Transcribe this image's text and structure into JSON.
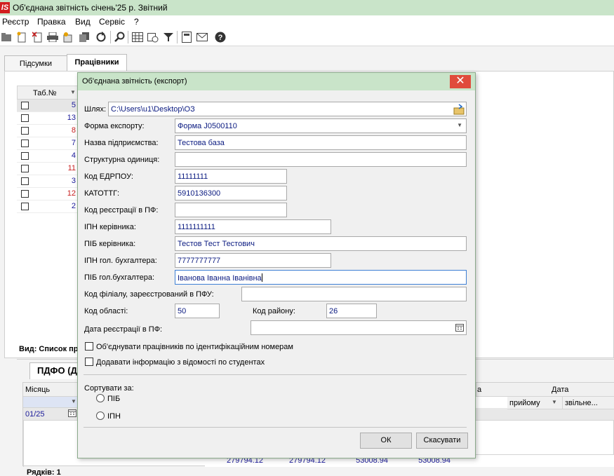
{
  "app": {
    "logo": "IS",
    "title": "Об'єднана звітність січень'25 р. Звітний"
  },
  "menu": [
    "Реєстр",
    "Правка",
    "Вид",
    "Сервіс",
    "?"
  ],
  "tabs": [
    "Підсумки",
    "Працівники"
  ],
  "workers": {
    "header": "Таб.№",
    "rows": [
      {
        "num": "5",
        "color": "#1a1a9a"
      },
      {
        "num": "13",
        "color": "#1a1a9a"
      },
      {
        "num": "8",
        "color": "#c81e1e"
      },
      {
        "num": "7",
        "color": "#1a1a9a"
      },
      {
        "num": "4",
        "color": "#1a1a9a"
      },
      {
        "num": "11",
        "color": "#c81e1e"
      },
      {
        "num": "3",
        "color": "#1a1a9a"
      },
      {
        "num": "12",
        "color": "#c81e1e"
      },
      {
        "num": "2",
        "color": "#1a1a9a"
      }
    ]
  },
  "view_label": "Вид: Список пра",
  "bottom": {
    "tab": "ПДФО (До",
    "col_month": "Місяць",
    "col_a": "а",
    "col_date": "Дата",
    "col_hire": "прийому",
    "col_fire": "звільне...",
    "month_value": "01/25",
    "totals": [
      "279794.12",
      "279794.12",
      "53008.94",
      "53008.94"
    ],
    "rows_label": "Рядків: 1"
  },
  "dialog": {
    "title": "Об'єднана звітність (експорт)",
    "close": "✕",
    "path_label": "Шлях:",
    "path_value": "C:\\Users\\u1\\Desktop\\ОЗ",
    "form_label": "Форма експорту:",
    "form_value": "Форма J0500110",
    "company_label": "Назва підприємства:",
    "company_value": "Тестова база",
    "unit_label": "Структурна одиниця:",
    "unit_value": "",
    "edrpou_label": "Код ЕДРПОУ:",
    "edrpou_value": "11111111",
    "katottg_label": "КАТОТТГ:",
    "katottg_value": "5910136300",
    "pf_code_label": "Код реєстрації в ПФ:",
    "pf_code_value": "",
    "director_ipn_label": "ІПН керівника:",
    "director_ipn_value": "1111111111",
    "director_name_label": "ПІБ керівника:",
    "director_name_value": "Тестов Тест Тестович",
    "accountant_ipn_label": "ІПН гол. бухгалтера:",
    "accountant_ipn_value": "7777777777",
    "accountant_name_label": "ПІБ  гол.бухгалтера:",
    "accountant_name_value": "Іванова Іванна Іванівна",
    "branch_label": "Код філіалу, зареєстрований в ПФУ:",
    "branch_value": "",
    "region_label": "Код області:",
    "region_value": "50",
    "district_label": "Код району:",
    "district_value": "26",
    "pf_date_label": "Дата реєстрації в ПФ:",
    "pf_date_value": "",
    "merge_label": "Об'єднувати працівників по ідентифікаційним номерам",
    "students_label": "Додавати інформацію з відомості по студентах",
    "sort_label": "Сортувати за:",
    "sort_pib": "ПІБ",
    "sort_ipn": "ІПН",
    "ok": "ОК",
    "cancel": "Скасувати"
  }
}
